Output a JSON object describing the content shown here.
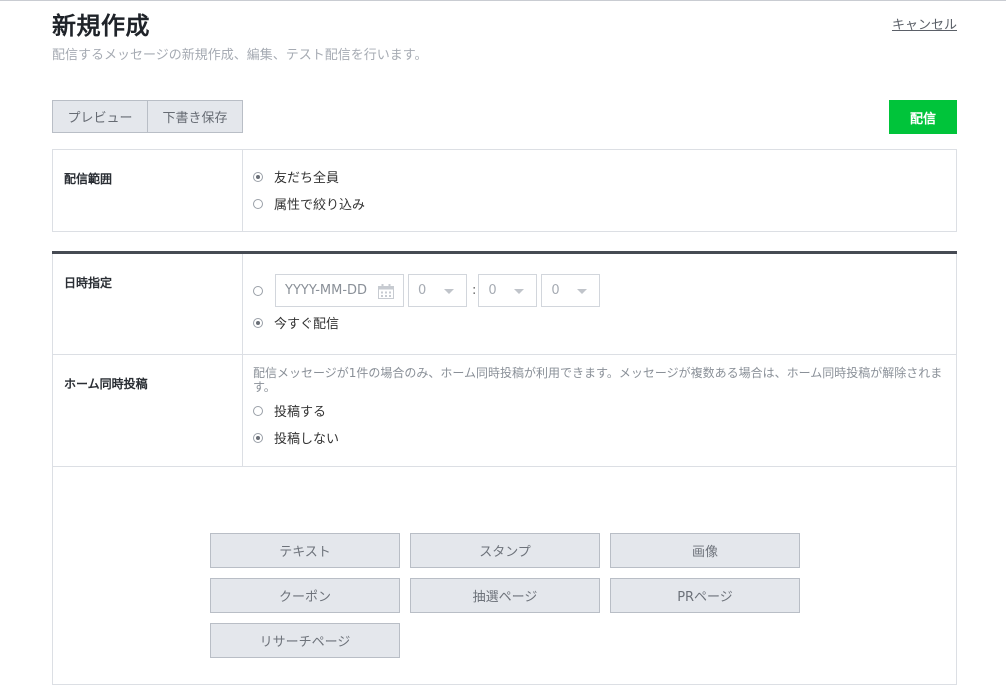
{
  "header": {
    "title": "新規作成",
    "subtitle": "配信するメッセージの新規作成、編集、テスト配信を行います。",
    "cancel_label": "キャンセル"
  },
  "toolbar": {
    "preview_label": "プレビュー",
    "draft_label": "下書き保存",
    "send_label": "配信"
  },
  "scope": {
    "label": "配信範囲",
    "options": [
      "友だち全員",
      "属性で絞り込み"
    ],
    "selected": "友だち全員"
  },
  "schedule": {
    "label": "日時指定",
    "date_placeholder": "YYYY-MM-DD",
    "hour_value": "0",
    "minute_value": "0",
    "second_value": "0",
    "now_label": "今すぐ配信",
    "selected": "今すぐ配信",
    "colon": ":"
  },
  "home_post": {
    "label": "ホーム同時投稿",
    "note": "配信メッセージが1件の場合のみ、ホーム同時投稿が利用できます。メッセージが複数ある場合は、ホーム同時投稿が解除されます。",
    "options": [
      "投稿する",
      "投稿しない"
    ],
    "selected": "投稿しない"
  },
  "message_types": [
    "テキスト",
    "スタンプ",
    "画像",
    "クーポン",
    "抽選ページ",
    "PRページ",
    "リサーチページ"
  ],
  "colors": {
    "send_button": "#00c43a",
    "divider": "#464b53",
    "button_bg": "#e4e7ec"
  }
}
